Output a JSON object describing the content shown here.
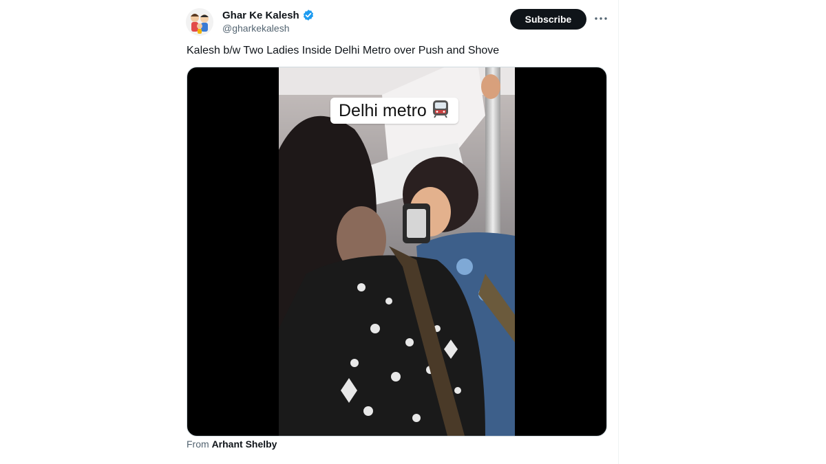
{
  "account": {
    "display_name": "Ghar Ke Kalesh",
    "handle": "@gharkekalesh",
    "avatar_icon": "cartoon-family-avatar-icon",
    "verified_icon": "verified-badge-icon",
    "verified_color": "#1d9bf0"
  },
  "actions": {
    "subscribe_label": "Subscribe",
    "more_icon": "more-options-icon"
  },
  "tweet": {
    "text": "Kalesh b/w Two Ladies Inside Delhi Metro over Push and Shove"
  },
  "media": {
    "caption": "Delhi metro",
    "caption_icon": "metro-train-icon",
    "from_prefix": "From",
    "from_name": "Arhant Shelby"
  }
}
